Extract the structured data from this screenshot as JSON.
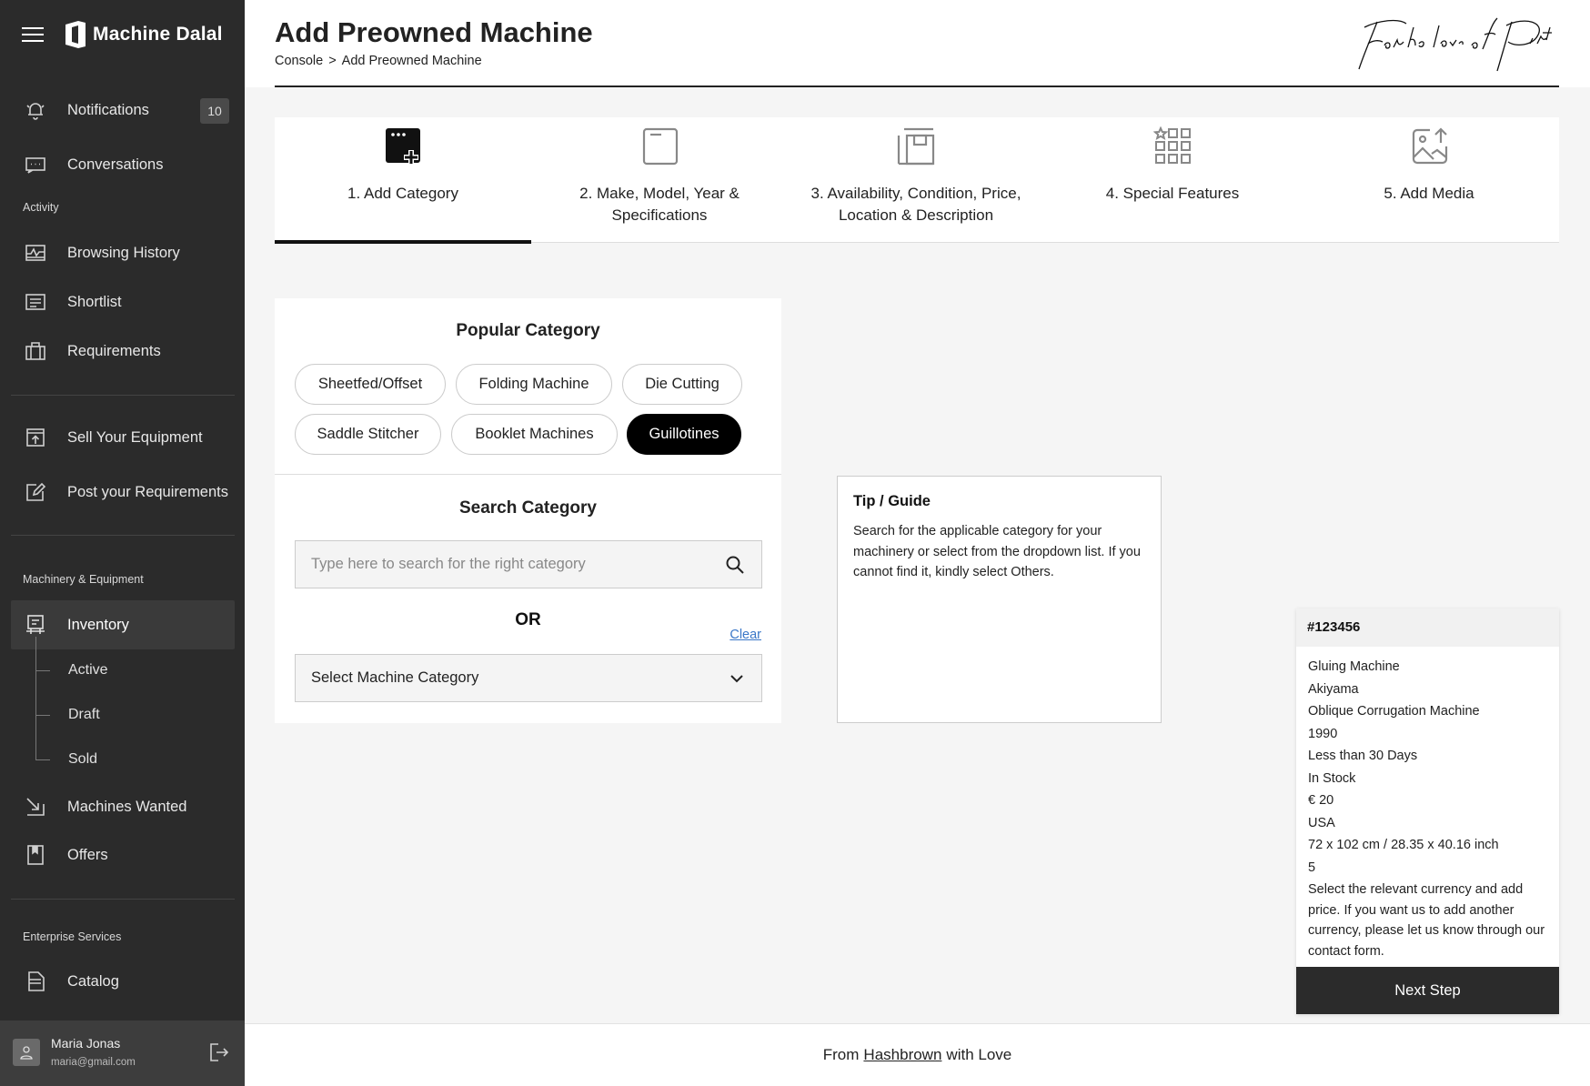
{
  "app": {
    "name": "Machine Dalal"
  },
  "sidebar": {
    "notifications": {
      "label": "Notifications",
      "count": "10"
    },
    "conversations": {
      "label": "Conversations"
    },
    "activity_label": "Activity",
    "browsing_history": {
      "label": "Browsing History"
    },
    "shortlist": {
      "label": "Shortlist"
    },
    "requirements": {
      "label": "Requirements"
    },
    "sell_equipment": {
      "label": "Sell Your Equipment"
    },
    "post_requirements": {
      "label": "Post your Requirements"
    },
    "machinery_label": "Machinery & Equipment",
    "inventory": {
      "label": "Inventory",
      "subitems": [
        "Active",
        "Draft",
        "Sold"
      ]
    },
    "machines_wanted": {
      "label": "Machines Wanted"
    },
    "offers": {
      "label": "Offers"
    },
    "enterprise_label": "Enterprise Services",
    "catalog": {
      "label": "Catalog"
    },
    "user": {
      "name": "Maria Jonas",
      "email": "maria@gmail.com"
    }
  },
  "header": {
    "title": "Add Preowned Machine",
    "breadcrumb": {
      "root": "Console",
      "separator": ">",
      "current": "Add Preowned Machine"
    }
  },
  "steps": [
    {
      "label": "1. Add Category",
      "active": true
    },
    {
      "label": "2. Make, Model, Year & Specifications"
    },
    {
      "label": "3. Availability, Condition, Price, Location & Description"
    },
    {
      "label": "4. Special Features"
    },
    {
      "label": "5. Add Media"
    }
  ],
  "category": {
    "popular_title": "Popular Category",
    "chips": [
      "Sheetfed/Offset",
      "Folding Machine",
      "Die Cutting",
      "Saddle Stitcher",
      "Booklet Machines",
      "Guillotines"
    ],
    "selected_chip": "Guillotines",
    "search_title": "Search Category",
    "search_placeholder": "Type here to search for the right category",
    "or_label": "OR",
    "clear_label": "Clear",
    "select_value": "Select Machine Category"
  },
  "tip": {
    "title": "Tip / Guide",
    "text": "Search for the applicable category for your machinery or select from the dropdown list. If you cannot find it, kindly select Others."
  },
  "summary": {
    "id": "#123456",
    "rows": [
      "Gluing Machine",
      "Akiyama",
      "Oblique Corrugation Machine",
      "1990",
      "Less than 30 Days",
      "In Stock",
      "€ 20",
      "USA",
      "72 x 102 cm / 28.35 x 40.16 inch",
      "5"
    ],
    "note": "Select the relevant currency and add price. If you want us to add another currency, please let us know through our contact form.",
    "next_label": "Next Step"
  },
  "footer": {
    "prefix": "From",
    "link": "Hashbrown",
    "suffix": "with Love"
  },
  "colors": {
    "sidebar_bg": "#2b2b2b",
    "accent_dark": "#000000",
    "link_blue": "#3a77c8",
    "page_bg": "#f5f5f5"
  }
}
